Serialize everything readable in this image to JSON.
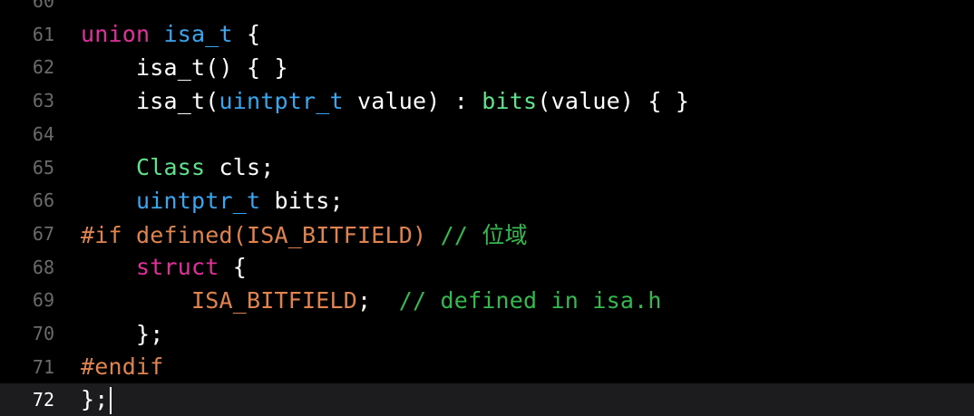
{
  "editor": {
    "current_line": "72",
    "lines": [
      {
        "number": "60",
        "tokens": []
      },
      {
        "number": "61",
        "tokens": [
          {
            "t": "union",
            "k": "keyword"
          },
          {
            "t": " ",
            "k": "plain"
          },
          {
            "t": "isa_t",
            "k": "type"
          },
          {
            "t": " {",
            "k": "plain"
          }
        ]
      },
      {
        "number": "62",
        "tokens": [
          {
            "t": "    isa_t() { }",
            "k": "plain"
          }
        ]
      },
      {
        "number": "63",
        "tokens": [
          {
            "t": "    isa_t(",
            "k": "plain"
          },
          {
            "t": "uintptr_t",
            "k": "type"
          },
          {
            "t": " value) : ",
            "k": "plain"
          },
          {
            "t": "bits",
            "k": "func"
          },
          {
            "t": "(value) { }",
            "k": "plain"
          }
        ]
      },
      {
        "number": "64",
        "tokens": []
      },
      {
        "number": "65",
        "tokens": [
          {
            "t": "    ",
            "k": "plain"
          },
          {
            "t": "Class",
            "k": "class"
          },
          {
            "t": " cls;",
            "k": "plain"
          }
        ]
      },
      {
        "number": "66",
        "tokens": [
          {
            "t": "    ",
            "k": "plain"
          },
          {
            "t": "uintptr_t",
            "k": "type"
          },
          {
            "t": " bits;",
            "k": "plain"
          }
        ]
      },
      {
        "number": "67",
        "tokens": [
          {
            "t": "#if defined(ISA_BITFIELD)",
            "k": "preproc"
          },
          {
            "t": " ",
            "k": "plain"
          },
          {
            "t": "// 位域",
            "k": "comment"
          }
        ]
      },
      {
        "number": "68",
        "tokens": [
          {
            "t": "    ",
            "k": "plain"
          },
          {
            "t": "struct",
            "k": "keyword"
          },
          {
            "t": " {",
            "k": "plain"
          }
        ]
      },
      {
        "number": "69",
        "tokens": [
          {
            "t": "        ",
            "k": "plain"
          },
          {
            "t": "ISA_BITFIELD",
            "k": "macro"
          },
          {
            "t": ";  ",
            "k": "plain"
          },
          {
            "t": "// defined in isa.h",
            "k": "comment"
          }
        ]
      },
      {
        "number": "70",
        "tokens": [
          {
            "t": "    };",
            "k": "plain"
          }
        ]
      },
      {
        "number": "71",
        "tokens": [
          {
            "t": "#endif",
            "k": "preproc"
          }
        ]
      },
      {
        "number": "72",
        "tokens": [
          {
            "t": "};",
            "k": "plain"
          }
        ]
      }
    ]
  }
}
